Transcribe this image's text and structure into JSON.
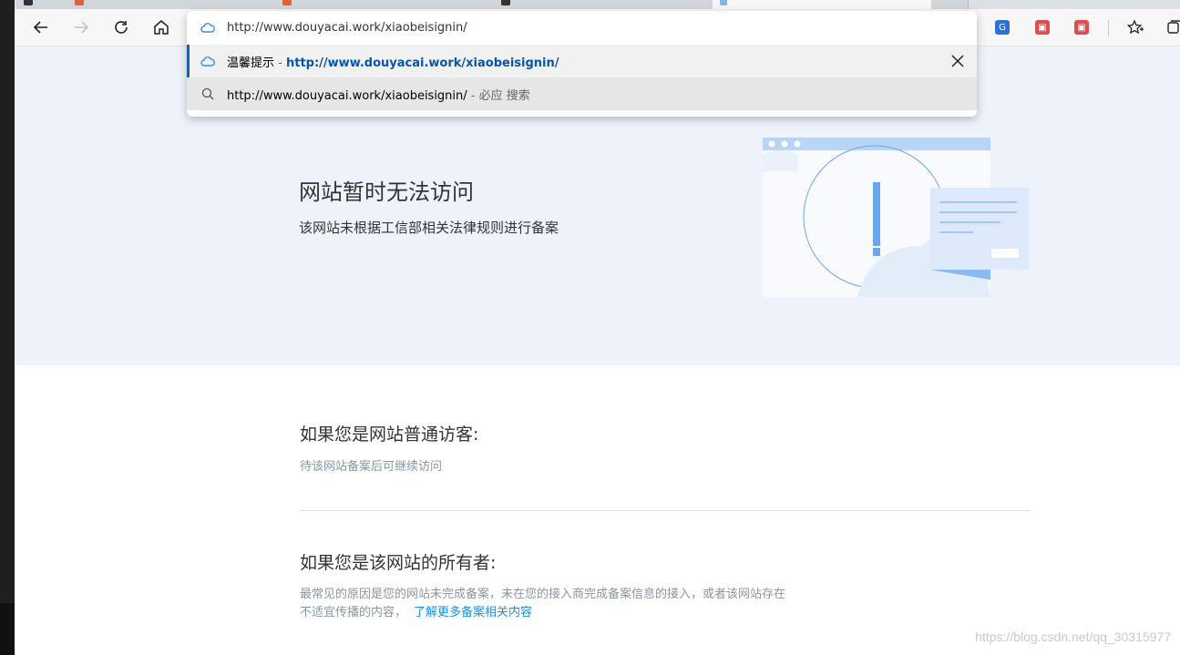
{
  "omnibox": {
    "input_value": "http://www.douyacai.work/xiaobeisignin/",
    "suggestion_title": "温馨提示",
    "suggestion_sep": " - ",
    "suggestion_url": "http://www.douyacai.work/xiaobeisignin/",
    "search_query": "http://www.douyacai.work/xiaobeisignin/",
    "search_suffix": " - 必应 搜索"
  },
  "toolbar_icons": [
    "back-icon",
    "forward-icon",
    "refresh-icon",
    "home-icon",
    "translate-icon",
    "extension-icon",
    "extension-icon",
    "favorites-icon",
    "collections-icon"
  ],
  "hero": {
    "title": "网站暂时无法访问",
    "subtitle": "该网站未根据工信部相关法律规则进行备案"
  },
  "visitor": {
    "title": "如果您是网站普通访客:",
    "text": "待该网站备案后可继续访问"
  },
  "owner": {
    "title": "如果您是该网站的所有者:",
    "text_line1": "最常见的原因是您的网站未完成备案，未在您的接入商完成备案信息的接入，或者该网站存在",
    "text_line2": "不适宜传播的内容，",
    "link": "了解更多备案相关内容"
  },
  "watermark": "https://blog.csdn.net/qq_30315977",
  "colors": {
    "hero_bg": "#eef3fb",
    "link": "#1e8fe0",
    "suggest_url": "#0a55a8",
    "accent_blue": "#6aa6ee"
  }
}
